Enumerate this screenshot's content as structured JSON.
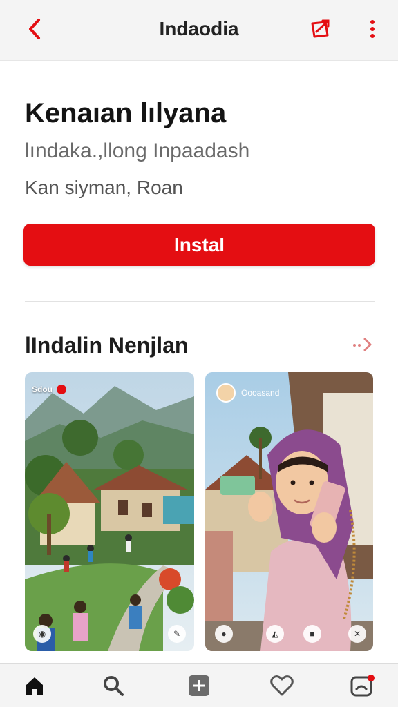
{
  "header": {
    "title": "Indaodia"
  },
  "app": {
    "name": "Kenaıan lılyana",
    "subtitle": "lındaka.,llong Inpaadash",
    "meta": "Kan siyman, Roan",
    "install_label": "Instal"
  },
  "section": {
    "title": "lIndalin Nenjlan"
  },
  "screenshots": [
    {
      "label": "Sdou"
    },
    {
      "label": "Oooasand"
    }
  ],
  "colors": {
    "accent": "#e40e12",
    "background": "#ffffff",
    "bar": "#f4f4f4"
  },
  "icons": {
    "back": "chevron-left-icon",
    "share": "share-icon",
    "more": "more-vertical-icon",
    "section_more": "arrow-right-icon",
    "nav": [
      "home-icon",
      "search-icon",
      "add-icon",
      "heart-icon",
      "notification-icon"
    ]
  }
}
